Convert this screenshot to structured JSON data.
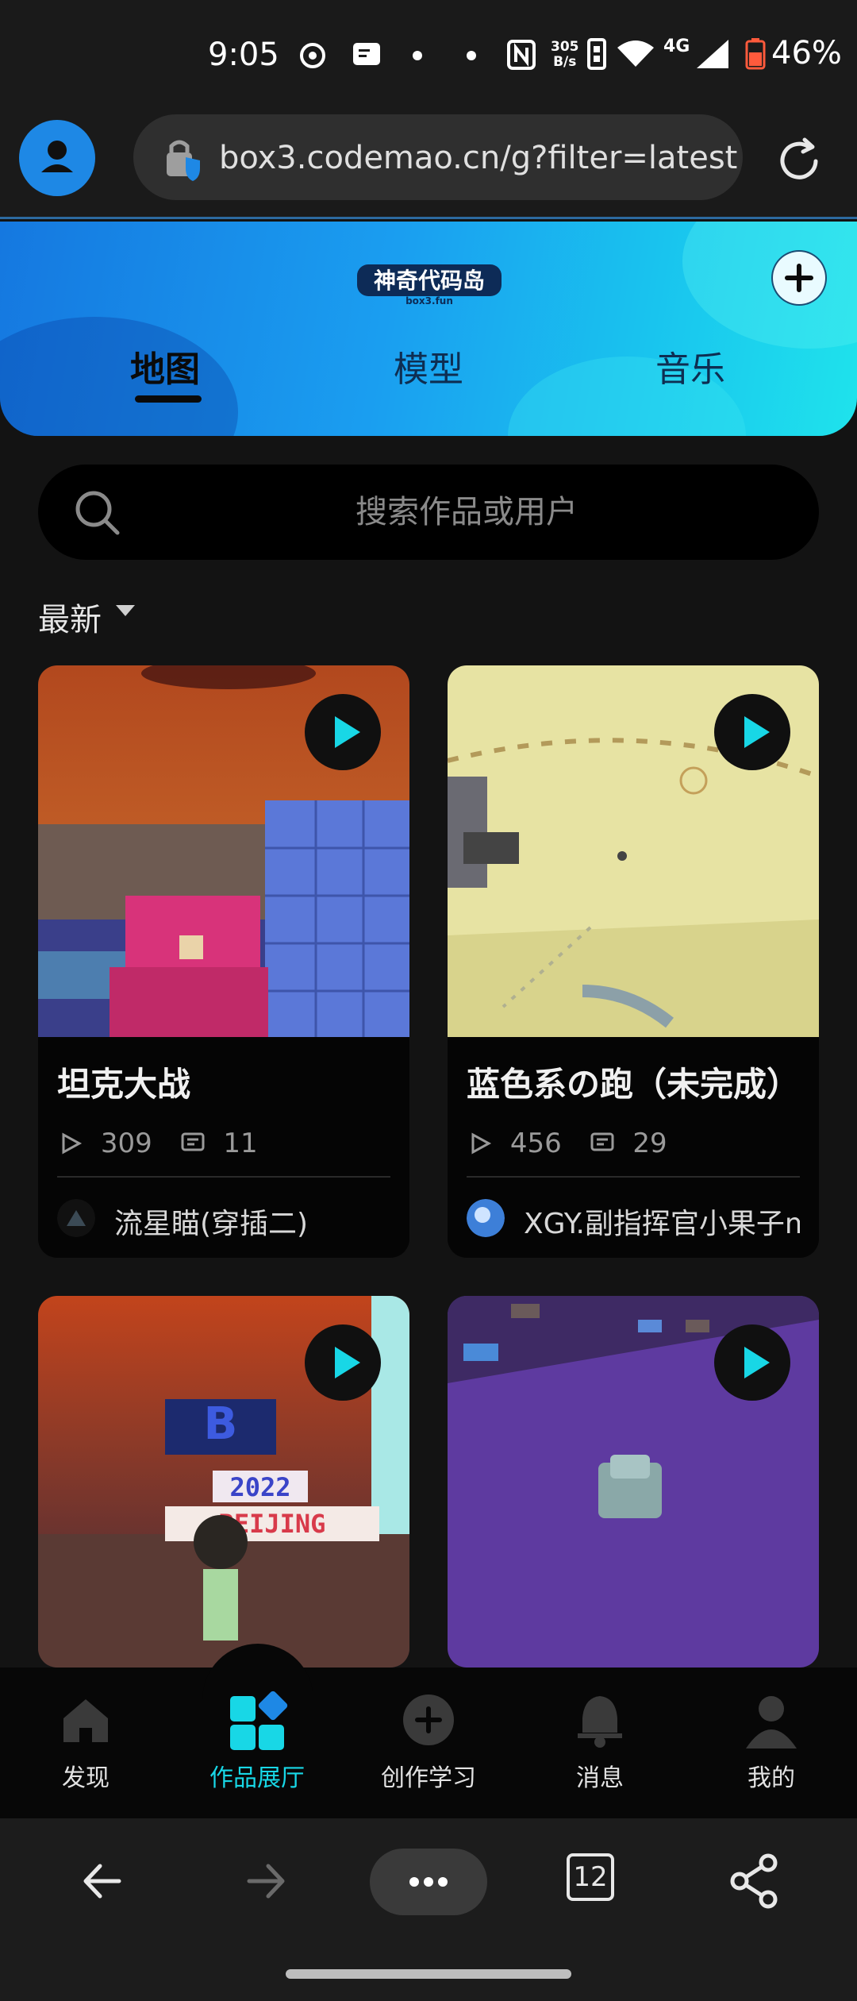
{
  "status_bar": {
    "time": "9:05",
    "net_speed_value": "305",
    "net_speed_unit": "B/s",
    "network": "4G",
    "battery": "46%"
  },
  "browser": {
    "url": "box3.codemao.cn/g?filter=latest",
    "tabs_count": "12"
  },
  "hero": {
    "logo_text": "神奇代码岛",
    "logo_sub": "box3.fun",
    "tabs": [
      {
        "label": "地图",
        "active": true
      },
      {
        "label": "模型",
        "active": false
      },
      {
        "label": "音乐",
        "active": false
      }
    ]
  },
  "search": {
    "placeholder": "搜索作品或用户"
  },
  "sort": {
    "label": "最新"
  },
  "cards": [
    {
      "title": "坦克大战",
      "plays": "309",
      "comments": "11",
      "author": "流星瞄(穿插二)"
    },
    {
      "title": "蓝色系の跑（未完成）",
      "plays": "456",
      "comments": "29",
      "author": "XGY.副指挥官小果子m"
    },
    {
      "title": "",
      "plays": "",
      "comments": "",
      "author": "",
      "scene_text_1": "2022",
      "scene_text_2": "BEIJING"
    },
    {
      "title": "",
      "plays": "",
      "comments": "",
      "author": ""
    }
  ],
  "app_nav": [
    {
      "label": "发现",
      "icon": "home-icon"
    },
    {
      "label": "作品展厅",
      "icon": "gallery-icon",
      "active": true
    },
    {
      "label": "创作学习",
      "icon": "create-plus-icon"
    },
    {
      "label": "消息",
      "icon": "bell-icon"
    },
    {
      "label": "我的",
      "icon": "profile-icon"
    }
  ],
  "colors": {
    "accent": "#18d7e6",
    "hero_start": "#1578e0",
    "hero_end": "#1fe3ec",
    "background": "#131313"
  }
}
